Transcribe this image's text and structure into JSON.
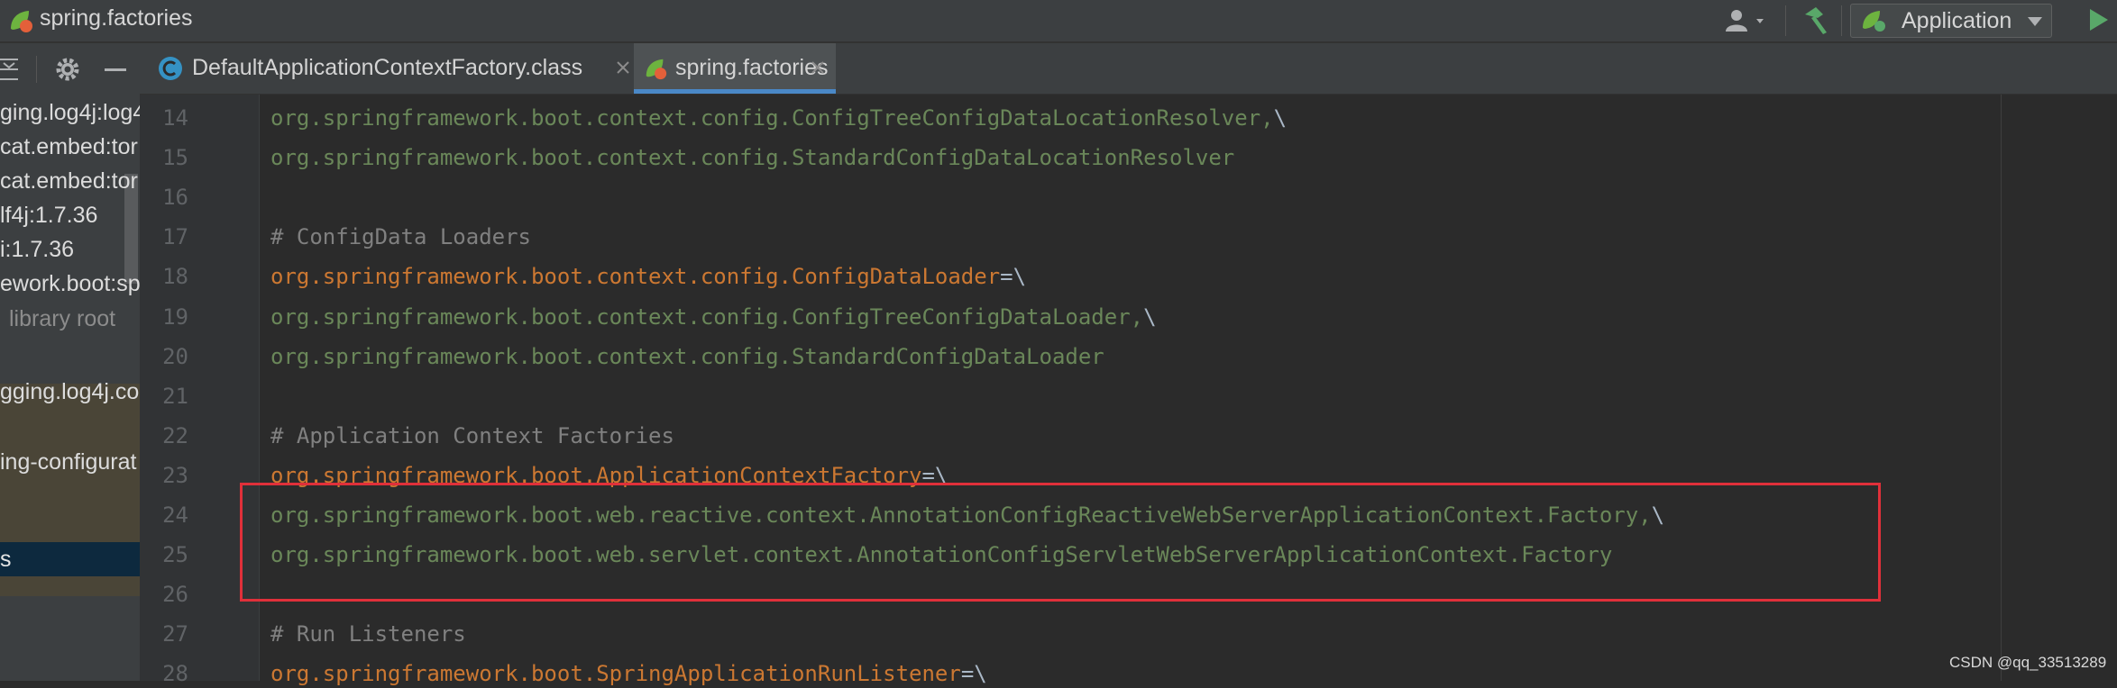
{
  "window": {
    "title": "spring.factories"
  },
  "toolbar": {
    "run_config_label": "Application"
  },
  "sidebar": {
    "items": [
      {
        "label": "ging.log4j:log4",
        "style": "normal"
      },
      {
        "label": "cat.embed:tor",
        "style": "normal"
      },
      {
        "label": "cat.embed:tor",
        "style": "normal"
      },
      {
        "label": "lf4j:1.7.36",
        "style": "normal"
      },
      {
        "label": "i:1.7.36",
        "style": "normal"
      },
      {
        "label": "ework.boot:spr",
        "style": "normal"
      },
      {
        "label": "library root",
        "style": "dim"
      },
      {
        "label": "gging.log4j.cor",
        "style": "normal"
      },
      {
        "label": "ing-configurat",
        "style": "normal"
      },
      {
        "label": "s",
        "style": "selected"
      }
    ]
  },
  "tabs": [
    {
      "label": "DefaultApplicationContextFactory.class",
      "icon": "class-file-icon",
      "active": false
    },
    {
      "label": "spring.factories",
      "icon": "spring-leaf-icon",
      "active": true
    }
  ],
  "editor": {
    "lines": [
      {
        "no": "14",
        "parts": [
          {
            "t": "org.springframework.boot.context.config.ConfigTreeConfigDataLocationResolver,",
            "c": "tok-val"
          },
          {
            "t": "\\",
            "c": "tok-op"
          }
        ]
      },
      {
        "no": "15",
        "parts": [
          {
            "t": "org.springframework.boot.context.config.StandardConfigDataLocationResolver",
            "c": "tok-val"
          }
        ]
      },
      {
        "no": "16",
        "parts": []
      },
      {
        "no": "17",
        "parts": [
          {
            "t": "# ConfigData Loaders",
            "c": "tok-comment"
          }
        ]
      },
      {
        "no": "18",
        "parts": [
          {
            "t": "org.springframework.boot.context.config.ConfigDataLoader",
            "c": "tok-key"
          },
          {
            "t": "=\\",
            "c": "tok-op"
          }
        ]
      },
      {
        "no": "19",
        "parts": [
          {
            "t": "org.springframework.boot.context.config.ConfigTreeConfigDataLoader,",
            "c": "tok-val"
          },
          {
            "t": "\\",
            "c": "tok-op"
          }
        ]
      },
      {
        "no": "20",
        "parts": [
          {
            "t": "org.springframework.boot.context.config.StandardConfigDataLoader",
            "c": "tok-val"
          }
        ]
      },
      {
        "no": "21",
        "parts": []
      },
      {
        "no": "22",
        "parts": [
          {
            "t": "# Application Context Factories",
            "c": "tok-comment"
          }
        ]
      },
      {
        "no": "23",
        "parts": [
          {
            "t": "org.springframework.boot.ApplicationContextFactory",
            "c": "tok-key"
          },
          {
            "t": "=\\",
            "c": "tok-op"
          }
        ]
      },
      {
        "no": "24",
        "parts": [
          {
            "t": "org.springframework.boot.web.reactive.context.AnnotationConfigReactiveWebServerApplicationContext.Factory,",
            "c": "tok-val"
          },
          {
            "t": "\\",
            "c": "tok-op"
          }
        ]
      },
      {
        "no": "25",
        "parts": [
          {
            "t": "org.springframework.boot.web.servlet.context.AnnotationConfigServletWebServerApplicationContext.Factory",
            "c": "tok-val"
          }
        ]
      },
      {
        "no": "26",
        "parts": []
      },
      {
        "no": "27",
        "parts": [
          {
            "t": "# Run Listeners",
            "c": "tok-comment"
          }
        ]
      },
      {
        "no": "28",
        "parts": [
          {
            "t": "org.springframework.boot.SpringApplicationRunListener",
            "c": "tok-key"
          },
          {
            "t": "=\\",
            "c": "tok-op"
          }
        ]
      }
    ]
  },
  "watermark": "CSDN @qq_33513289",
  "colors": {
    "accent": "#4a88c7",
    "highlight_border": "#e0303a",
    "keyword_orange": "#cc7832",
    "string_green": "#6a8759",
    "comment_gray": "#808080"
  }
}
